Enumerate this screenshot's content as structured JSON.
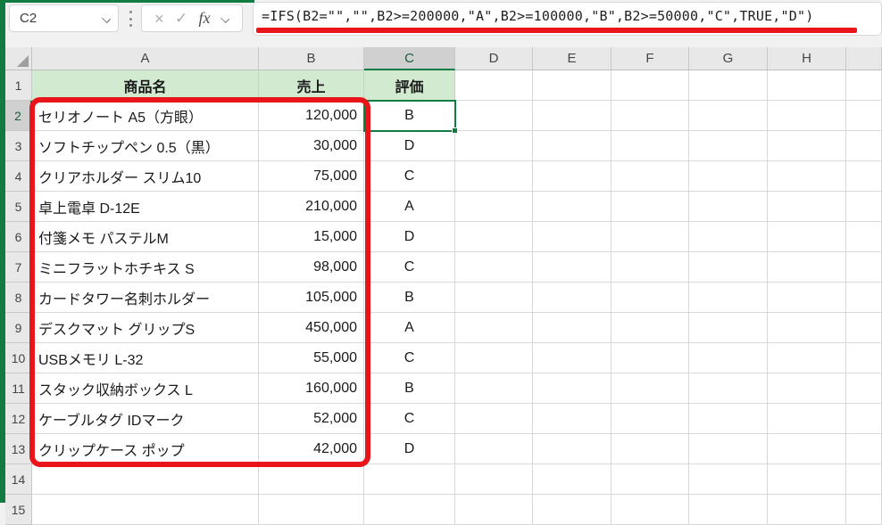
{
  "formula_bar": {
    "name_box_value": "C2",
    "cancel_icon": "×",
    "enter_icon": "✓",
    "fx_label": "fx",
    "formula": "=IFS(B2=\"\",\"\",B2>=200000,\"A\",B2>=100000,\"B\",B2>=50000,\"C\",TRUE,\"D\")"
  },
  "colors": {
    "excel_green": "#107C41",
    "header_fill_green": "#D2EAD0",
    "annotation_red": "#E9151B",
    "selected_header_bg": "#D0D0D0"
  },
  "sheet": {
    "selected_cell": "C2",
    "selected_column": "C",
    "selected_row": 2,
    "column_letters": [
      "A",
      "B",
      "C",
      "D",
      "E",
      "F",
      "G",
      "H",
      ""
    ],
    "row_numbers": [
      "1",
      "2",
      "3",
      "4",
      "5",
      "6",
      "7",
      "8",
      "9",
      "10",
      "11",
      "12",
      "13",
      "14",
      "15"
    ],
    "header_row": {
      "product": "商品名",
      "sales": "売上",
      "grade": "評価"
    },
    "rows": [
      {
        "row": 2,
        "product": "セリオノート A5（方眼）",
        "sales": "120,000",
        "grade": "B"
      },
      {
        "row": 3,
        "product": "ソフトチップペン 0.5（黒）",
        "sales": "30,000",
        "grade": "D"
      },
      {
        "row": 4,
        "product": "クリアホルダー スリム10",
        "sales": "75,000",
        "grade": "C"
      },
      {
        "row": 5,
        "product": "卓上電卓 D-12E",
        "sales": "210,000",
        "grade": "A"
      },
      {
        "row": 6,
        "product": "付箋メモ パステルM",
        "sales": "15,000",
        "grade": "D"
      },
      {
        "row": 7,
        "product": "ミニフラットホチキス S",
        "sales": "98,000",
        "grade": "C"
      },
      {
        "row": 8,
        "product": "カードタワー名刺ホルダー",
        "sales": "105,000",
        "grade": "B"
      },
      {
        "row": 9,
        "product": "デスクマット グリップS",
        "sales": "450,000",
        "grade": "A"
      },
      {
        "row": 10,
        "product": "USBメモリ L-32",
        "sales": "55,000",
        "grade": "C"
      },
      {
        "row": 11,
        "product": "スタック収納ボックス L",
        "sales": "160,000",
        "grade": "B"
      },
      {
        "row": 12,
        "product": "ケーブルタグ IDマーク",
        "sales": "52,000",
        "grade": "C"
      },
      {
        "row": 13,
        "product": "クリップケース ポップ",
        "sales": "42,000",
        "grade": "D"
      }
    ]
  }
}
